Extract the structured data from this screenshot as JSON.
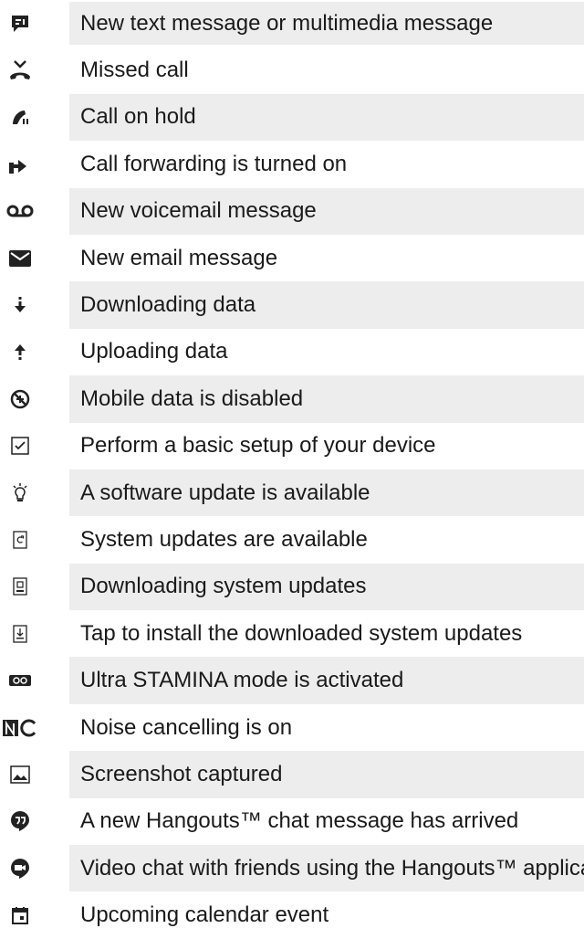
{
  "rows": [
    {
      "icon": "sms-message-icon",
      "text": "New text message or multimedia message"
    },
    {
      "icon": "missed-call-icon",
      "text": "Missed call"
    },
    {
      "icon": "call-on-hold-icon",
      "text": "Call on hold"
    },
    {
      "icon": "call-forwarding-icon",
      "text": "Call forwarding is turned on"
    },
    {
      "icon": "voicemail-icon",
      "text": "New voicemail message"
    },
    {
      "icon": "email-icon",
      "text": "New email message"
    },
    {
      "icon": "download-icon",
      "text": "Downloading data"
    },
    {
      "icon": "upload-icon",
      "text": "Uploading data"
    },
    {
      "icon": "mobile-data-disabled-icon",
      "text": "Mobile data is disabled"
    },
    {
      "icon": "setup-checkbox-icon",
      "text": "Perform a basic setup of your device"
    },
    {
      "icon": "software-update-icon",
      "text": "A software update is available"
    },
    {
      "icon": "system-update-icon",
      "text": "System updates are available"
    },
    {
      "icon": "downloading-system-update-icon",
      "text": "Downloading system updates"
    },
    {
      "icon": "install-system-update-icon",
      "text": "Tap to install the downloaded system updates"
    },
    {
      "icon": "ultra-stamina-icon",
      "text": "Ultra STAMINA mode is activated"
    },
    {
      "icon": "noise-cancelling-icon",
      "text": "Noise cancelling is on"
    },
    {
      "icon": "screenshot-icon",
      "text": "Screenshot captured"
    },
    {
      "icon": "hangouts-message-icon",
      "text": "A new Hangouts™ chat message has arrived"
    },
    {
      "icon": "hangouts-video-icon",
      "text": "Video chat with friends using the Hangouts™ application"
    },
    {
      "icon": "calendar-event-icon",
      "text": "Upcoming calendar event"
    }
  ]
}
